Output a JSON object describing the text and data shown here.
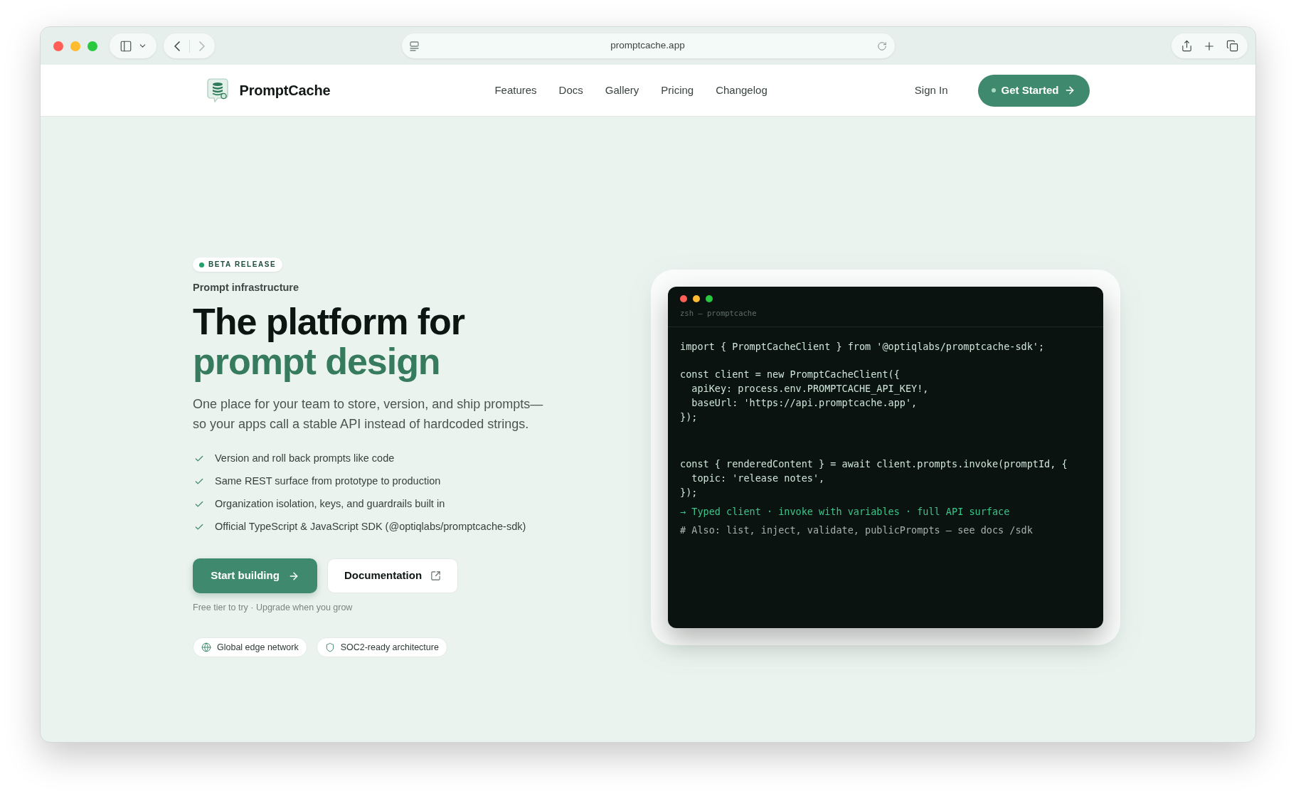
{
  "browser": {
    "url": "promptcache.app",
    "nav_buttons": [
      {
        "kind": "back",
        "disabled": false
      },
      {
        "kind": "forward",
        "disabled": true
      }
    ]
  },
  "header": {
    "brand": "PromptCache",
    "nav": [
      "Features",
      "Docs",
      "Gallery",
      "Pricing",
      "Changelog"
    ],
    "sign_in": "Sign In",
    "cta": "Get Started"
  },
  "hero": {
    "badge": "BETA RELEASE",
    "eyebrow": "Prompt infrastructure",
    "title": "The platform for",
    "title_highlight": "prompt design",
    "description": "One place for your team to store, version, and ship prompts—so your apps call a stable API instead of hardcoded strings.",
    "features": [
      "Version and roll back prompts like code",
      "Same REST surface from prototype to production",
      "Organization isolation, keys, and guardrails built in",
      "Official TypeScript & JavaScript SDK (@optiqlabs/promptcache-sdk)"
    ],
    "buttons": [
      {
        "kind": "primary",
        "label": "Start building"
      },
      {
        "kind": "secondary",
        "label": "Documentation"
      }
    ],
    "note": "Free tier to try · Upgrade when you grow",
    "chips": [
      {
        "kind": "globe",
        "label": "Global edge network"
      },
      {
        "kind": "shield",
        "label": "SOC2-ready architecture"
      }
    ]
  },
  "terminal": {
    "title": "zsh — promptcache",
    "code_blocks": [
      [
        "import { PromptCacheClient } from '@optiqlabs/promptcache-sdk';"
      ],
      [
        "const client = new PromptCacheClient({",
        "  apiKey: process.env.PROMPTCACHE_API_KEY!,",
        "  baseUrl: 'https://api.promptcache.app',",
        "});"
      ],
      [
        "const { renderedContent } = await client.prompts.invoke(promptId, {",
        "  topic: 'release notes',",
        "});"
      ]
    ],
    "notes": [
      {
        "kind": "highlight",
        "text": "→ Typed client · invoke with variables · full API surface"
      },
      {
        "kind": "comment",
        "text": "# Also: list, inject, validate, publicPrompts — see docs /sdk"
      }
    ]
  }
}
